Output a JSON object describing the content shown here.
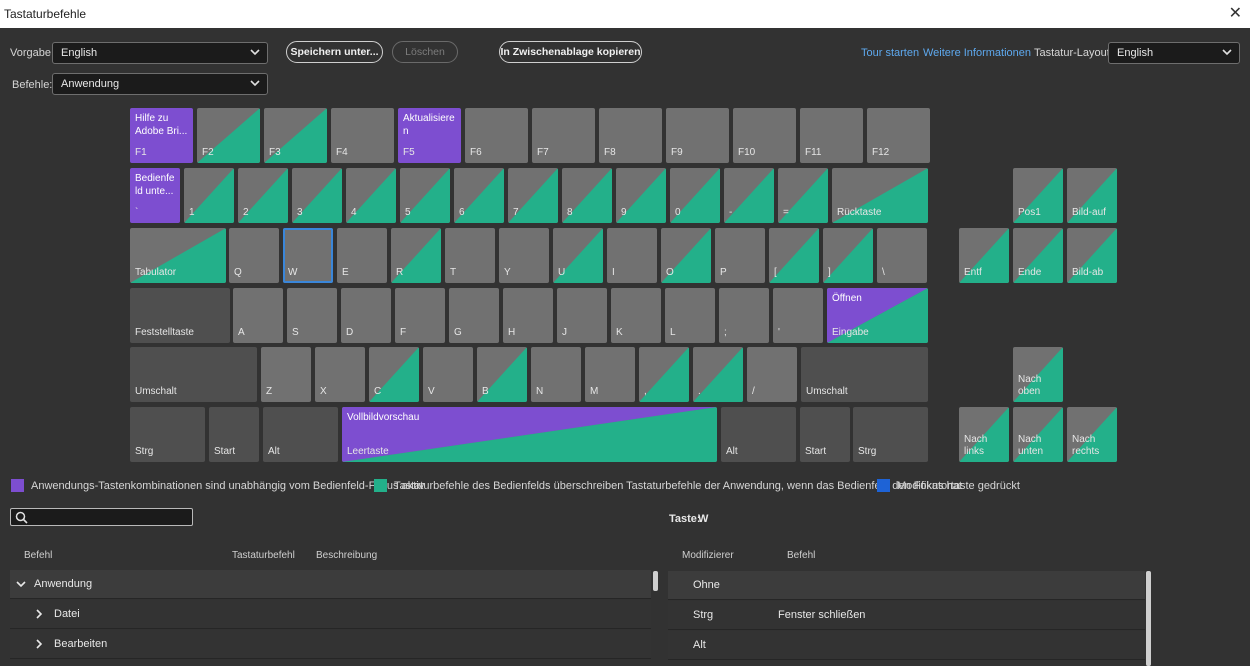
{
  "window": {
    "title": "Tastaturbefehle"
  },
  "toolbar": {
    "preset_label": "Vorgabe:",
    "preset_value": "English",
    "save_as": "Speichern unter...",
    "delete": "Löschen",
    "copy_clipboard": "In Zwischenablage kopieren",
    "tour": "Tour starten",
    "more_info": "Weitere Informationen",
    "layout_label": "Tastatur-Layout:",
    "layout_value": "English",
    "commands_label": "Befehle:",
    "commands_value": "Anwendung"
  },
  "colors": {
    "app": "#7d4ed0",
    "panel": "#23b08a",
    "modifier": "#1e63d6",
    "key": "#717171",
    "key_dark": "#4f4f4f"
  },
  "keyboard": {
    "fn_row": [
      {
        "label": "F1",
        "type": "app",
        "top": "Hilfe zu Adobe Bri..."
      },
      {
        "label": "F2",
        "type": "panel"
      },
      {
        "label": "F3",
        "type": "panel"
      },
      {
        "label": "F4",
        "type": "none"
      },
      {
        "label": "F5",
        "type": "app",
        "top": "Aktualisiere n"
      },
      {
        "label": "F6",
        "type": "none"
      },
      {
        "label": "F7",
        "type": "none"
      },
      {
        "label": "F8",
        "type": "none"
      },
      {
        "label": "F9",
        "type": "none"
      },
      {
        "label": "F10",
        "type": "none"
      },
      {
        "label": "F11",
        "type": "none"
      },
      {
        "label": "F12",
        "type": "none"
      }
    ],
    "num_row": [
      {
        "label": "`",
        "type": "app",
        "top": "Bedienfe ld unte..."
      },
      {
        "label": "1",
        "type": "panel"
      },
      {
        "label": "2",
        "type": "panel"
      },
      {
        "label": "3",
        "type": "panel"
      },
      {
        "label": "4",
        "type": "panel"
      },
      {
        "label": "5",
        "type": "panel"
      },
      {
        "label": "6",
        "type": "panel"
      },
      {
        "label": "7",
        "type": "panel"
      },
      {
        "label": "8",
        "type": "panel"
      },
      {
        "label": "9",
        "type": "panel"
      },
      {
        "label": "0",
        "type": "panel"
      },
      {
        "label": "-",
        "type": "panel"
      },
      {
        "label": "=",
        "type": "panel"
      },
      {
        "label": "Rücktaste",
        "type": "panel"
      }
    ],
    "q_row": [
      {
        "label": "Tabulator",
        "type": "panel"
      },
      {
        "label": "Q",
        "type": "none"
      },
      {
        "label": "W",
        "type": "none"
      },
      {
        "label": "E",
        "type": "none"
      },
      {
        "label": "R",
        "type": "panel"
      },
      {
        "label": "T",
        "type": "none"
      },
      {
        "label": "Y",
        "type": "none"
      },
      {
        "label": "U",
        "type": "panel"
      },
      {
        "label": "I",
        "type": "none"
      },
      {
        "label": "O",
        "type": "panel"
      },
      {
        "label": "P",
        "type": "none"
      },
      {
        "label": "[",
        "type": "panel"
      },
      {
        "label": "]",
        "type": "panel"
      },
      {
        "label": "\\",
        "type": "none"
      }
    ],
    "a_row": [
      {
        "label": "Feststelltaste",
        "type": "dark"
      },
      {
        "label": "A",
        "type": "none"
      },
      {
        "label": "S",
        "type": "none"
      },
      {
        "label": "D",
        "type": "none"
      },
      {
        "label": "F",
        "type": "none"
      },
      {
        "label": "G",
        "type": "none"
      },
      {
        "label": "H",
        "type": "none"
      },
      {
        "label": "J",
        "type": "none"
      },
      {
        "label": "K",
        "type": "none"
      },
      {
        "label": "L",
        "type": "none"
      },
      {
        "label": ";",
        "type": "none"
      },
      {
        "label": "'",
        "type": "none"
      },
      {
        "label": "Eingabe",
        "type": "app-panel",
        "top": "Öffnen"
      }
    ],
    "z_row": [
      {
        "label": "Umschalt",
        "type": "dark"
      },
      {
        "label": "Z",
        "type": "none"
      },
      {
        "label": "X",
        "type": "none"
      },
      {
        "label": "C",
        "type": "panel"
      },
      {
        "label": "V",
        "type": "none"
      },
      {
        "label": "B",
        "type": "panel"
      },
      {
        "label": "N",
        "type": "none"
      },
      {
        "label": "M",
        "type": "none"
      },
      {
        "label": ",",
        "type": "panel"
      },
      {
        "label": ".",
        "type": "panel"
      },
      {
        "label": "/",
        "type": "none"
      },
      {
        "label": "Umschalt",
        "type": "dark"
      }
    ],
    "bottom_row": [
      {
        "label": "Strg",
        "type": "dark"
      },
      {
        "label": "Start",
        "type": "dark"
      },
      {
        "label": "Alt",
        "type": "dark"
      },
      {
        "label": "Leertaste",
        "type": "app-panel",
        "top": "Vollbildvorschau"
      },
      {
        "label": "Alt",
        "type": "dark"
      },
      {
        "label": "Start",
        "type": "dark"
      },
      {
        "label": "Strg",
        "type": "dark"
      }
    ],
    "nav": [
      {
        "label": "Pos1",
        "type": "panel"
      },
      {
        "label": "Bild-auf",
        "type": "panel"
      },
      {
        "label": "Entf",
        "type": "panel"
      },
      {
        "label": "Ende",
        "type": "panel"
      },
      {
        "label": "Bild-ab",
        "type": "panel"
      },
      {
        "label": "Nach oben",
        "type": "panel"
      },
      {
        "label": "Nach links",
        "type": "panel"
      },
      {
        "label": "Nach unten",
        "type": "panel"
      },
      {
        "label": "Nach rechts",
        "type": "panel"
      }
    ],
    "selected_key": "W"
  },
  "legend": {
    "app": "Anwendungs-Tastenkombinationen sind unabhängig vom Bedienfeld-Fokus aktiv",
    "panel": "Tastaturbefehle des Bedienfelds überschreiben Tastaturbefehle der Anwendung, wenn das Bedienfeld den Fokus hat",
    "modifier": "Modifikatortaste gedrückt"
  },
  "key_info": {
    "label": "Taste:",
    "value": "W"
  },
  "commands_table": {
    "headers": [
      "Befehl",
      "Tastaturbefehl",
      "Beschreibung"
    ],
    "rows": [
      {
        "label": "Anwendung",
        "expanded": true
      },
      {
        "label": "Datei",
        "expanded": false
      },
      {
        "label": "Bearbeiten",
        "expanded": false
      }
    ]
  },
  "modifier_table": {
    "headers": [
      "Modifizierer",
      "Befehl"
    ],
    "rows": [
      {
        "modifier": "Ohne",
        "command": ""
      },
      {
        "modifier": "Strg",
        "command": "Fenster schließen"
      },
      {
        "modifier": "Alt",
        "command": ""
      }
    ]
  }
}
